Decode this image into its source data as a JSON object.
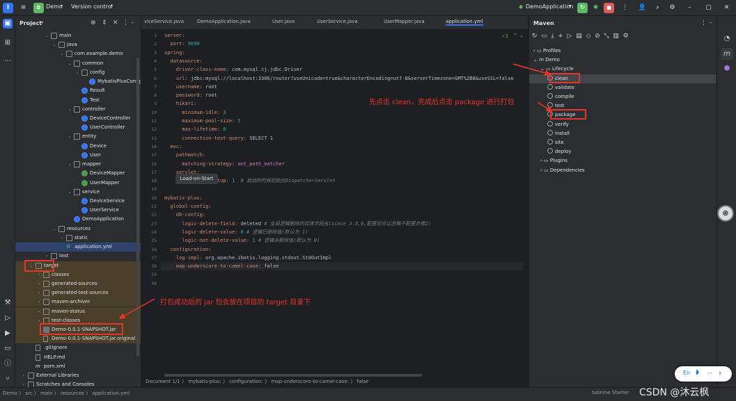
{
  "titlebar": {
    "project": "Demo",
    "vcs": "Version control",
    "run_config": "DemoApplication"
  },
  "project_panel": {
    "title": "Project",
    "tree": [
      {
        "label": "main",
        "indent": 3,
        "type": "folder",
        "open": true
      },
      {
        "label": "java",
        "indent": 4,
        "type": "folder",
        "open": true
      },
      {
        "label": "com.example.demo",
        "indent": 5,
        "type": "folder",
        "open": true
      },
      {
        "label": "common",
        "indent": 6,
        "type": "folder",
        "open": true
      },
      {
        "label": "config",
        "indent": 7,
        "type": "folder",
        "open": true
      },
      {
        "label": "MybatisPlusConfig",
        "indent": 8,
        "type": "class"
      },
      {
        "label": "Result",
        "indent": 7,
        "type": "class"
      },
      {
        "label": "Test",
        "indent": 7,
        "type": "class"
      },
      {
        "label": "controller",
        "indent": 6,
        "type": "folder",
        "open": true
      },
      {
        "label": "DeviceController",
        "indent": 7,
        "type": "class"
      },
      {
        "label": "UserController",
        "indent": 7,
        "type": "class"
      },
      {
        "label": "entity",
        "indent": 6,
        "type": "folder",
        "open": true
      },
      {
        "label": "Device",
        "indent": 7,
        "type": "class"
      },
      {
        "label": "User",
        "indent": 7,
        "type": "class"
      },
      {
        "label": "mapper",
        "indent": 6,
        "type": "folder",
        "open": true
      },
      {
        "label": "DeviceMapper",
        "indent": 7,
        "type": "interface"
      },
      {
        "label": "UserMapper",
        "indent": 7,
        "type": "interface"
      },
      {
        "label": "service",
        "indent": 6,
        "type": "folder",
        "open": true
      },
      {
        "label": "DeviceService",
        "indent": 7,
        "type": "class"
      },
      {
        "label": "UserService",
        "indent": 7,
        "type": "class"
      },
      {
        "label": "DemoApplication",
        "indent": 6,
        "type": "class"
      },
      {
        "label": "resources",
        "indent": 4,
        "type": "folder",
        "open": true
      },
      {
        "label": "static",
        "indent": 5,
        "type": "folder"
      },
      {
        "label": "application.yml",
        "indent": 5,
        "type": "yml",
        "selected": true
      },
      {
        "label": "test",
        "indent": 3,
        "type": "folder"
      },
      {
        "label": "target",
        "indent": 1,
        "type": "folder",
        "open": true,
        "orange": true
      },
      {
        "label": "classes",
        "indent": 2,
        "type": "folder",
        "orange": true
      },
      {
        "label": "generated-sources",
        "indent": 2,
        "type": "folder",
        "orange": true
      },
      {
        "label": "generated-test-sources",
        "indent": 2,
        "type": "folder",
        "orange": true
      },
      {
        "label": "maven-archiver",
        "indent": 2,
        "type": "folder",
        "orange": true
      },
      {
        "label": "maven-status",
        "indent": 2,
        "type": "folder",
        "orange": true
      },
      {
        "label": "test-classes",
        "indent": 2,
        "type": "folder",
        "orange": true
      },
      {
        "label": "Demo-0.0.1-SNAPSHOT.jar",
        "indent": 2,
        "type": "jar",
        "orange": true
      },
      {
        "label": "Demo-0.0.1-SNAPSHOT.jar.original",
        "indent": 2,
        "type": "file",
        "orange": true
      },
      {
        "label": ".gitignore",
        "indent": 1,
        "type": "file"
      },
      {
        "label": "HELP.md",
        "indent": 1,
        "type": "file"
      },
      {
        "label": "pom.xml",
        "indent": 1,
        "type": "pom"
      },
      {
        "label": "External Libraries",
        "indent": 0,
        "type": "lib"
      },
      {
        "label": "Scratches and Consoles",
        "indent": 0,
        "type": "lib"
      }
    ]
  },
  "editor": {
    "tabs": [
      "viceService.java",
      "DemoApplication.java",
      "User.java",
      "UserService.java",
      "UserMapper.java",
      "application.yml"
    ],
    "active_tab": "application.yml",
    "inspection": "✓1",
    "lines": [
      [
        [
          "k",
          "server:"
        ]
      ],
      [
        [
          "k",
          "  port: "
        ],
        [
          "n",
          "9090"
        ]
      ],
      [
        [
          "k",
          "spring:"
        ]
      ],
      [
        [
          "k",
          "  datasource:"
        ]
      ],
      [
        [
          "k",
          "    driver-class-name: "
        ],
        [
          "v",
          "com.mysql.cj.jdbc.Driver"
        ]
      ],
      [
        [
          "k",
          "    url: "
        ],
        [
          "v",
          "jdbc:mysql://localhost:3306/router?useUnicode=true&characterEncoding=utf-8&serverTimezone=GMT%2B8&useSSL=false"
        ]
      ],
      [
        [
          "k",
          "    username: "
        ],
        [
          "v",
          "root"
        ]
      ],
      [
        [
          "k",
          "    password: "
        ],
        [
          "v",
          "root"
        ]
      ],
      [
        [
          "k",
          "    hikari:"
        ]
      ],
      [
        [
          "k",
          "      minimum-idle: "
        ],
        [
          "n",
          "3"
        ]
      ],
      [
        [
          "k",
          "      maximum-pool-size: "
        ],
        [
          "n",
          "5"
        ]
      ],
      [
        [
          "k",
          "      max-lifetime: "
        ],
        [
          "n",
          "0"
        ]
      ],
      [
        [
          "k",
          "      connection-test-query: "
        ],
        [
          "v",
          "SELECT 1"
        ]
      ],
      [
        [
          "k",
          "  mvc:"
        ]
      ],
      [
        [
          "k",
          "    pathmatch:"
        ]
      ],
      [
        [
          "k",
          "      matching-strategy: "
        ],
        [
          "m",
          "ant_path_matcher"
        ]
      ],
      [
        [
          "k",
          "    servlet:"
        ]
      ],
      [
        [
          "k",
          "      load-on-startup: "
        ],
        [
          "n",
          "1"
        ],
        [
          "c",
          "  # 启动的时候初始化DispatcherServlet"
        ]
      ],
      [],
      [
        [
          "k",
          "mybatis-plus:"
        ]
      ],
      [
        [
          "k",
          "  global-config:"
        ]
      ],
      [
        [
          "k",
          "    db-config:"
        ]
      ],
      [
        [
          "k",
          "      logic-delete-field: "
        ],
        [
          "v",
          "deleted"
        ],
        [
          "c",
          " # 全局逻辑删除的实体字段名(since 3.3.0,配置后可以忽略不配置步骤2)"
        ]
      ],
      [
        [
          "k",
          "      logic-delete-value: "
        ],
        [
          "n",
          "0"
        ],
        [
          "c",
          " # 逻辑已删除值(默认为 1)"
        ]
      ],
      [
        [
          "k",
          "      logic-not-delete-value: "
        ],
        [
          "n",
          "1"
        ],
        [
          "c",
          " # 逻辑未删除值(默认为 0)"
        ]
      ],
      [
        [
          "k",
          "  configuration:"
        ]
      ],
      [
        [
          "k",
          "    log-impl: "
        ],
        [
          "v",
          "org.apache.ibatis.logging.stdout.StdOutImpl"
        ]
      ],
      [
        [
          "k",
          "    map-underscore-to-camel-case: "
        ],
        [
          "v",
          "false"
        ]
      ],
      [],
      []
    ],
    "hint": "Load-on-Start",
    "breadcrumbs": [
      "Document 1/1",
      "mybatis-plus:",
      "configuration:",
      "map-underscore-to-camel-case:",
      "false"
    ]
  },
  "maven": {
    "title": "Maven",
    "items": [
      {
        "label": "Profiles",
        "indent": 0,
        "kind": "folder"
      },
      {
        "label": "Demo",
        "indent": 0,
        "kind": "maven"
      },
      {
        "label": "Lifecycle",
        "indent": 1,
        "kind": "folder"
      },
      {
        "label": "clean",
        "indent": 2,
        "kind": "goal",
        "highlight": true
      },
      {
        "label": "validate",
        "indent": 2,
        "kind": "goal"
      },
      {
        "label": "compile",
        "indent": 2,
        "kind": "goal"
      },
      {
        "label": "test",
        "indent": 2,
        "kind": "goal"
      },
      {
        "label": "package",
        "indent": 2,
        "kind": "goal",
        "boxed": true
      },
      {
        "label": "verify",
        "indent": 2,
        "kind": "goal"
      },
      {
        "label": "install",
        "indent": 2,
        "kind": "goal"
      },
      {
        "label": "site",
        "indent": 2,
        "kind": "goal"
      },
      {
        "label": "deploy",
        "indent": 2,
        "kind": "goal"
      },
      {
        "label": "Plugins",
        "indent": 1,
        "kind": "folder"
      },
      {
        "label": "Dependencies",
        "indent": 1,
        "kind": "folder"
      }
    ]
  },
  "annotations": {
    "maven_note": "先点击 clean，完成后点击 package 进行打包",
    "target_note": "打包成功后的 jar 包会放在项目的 target 目录下"
  },
  "statusbar": {
    "path": [
      "Demo",
      "src",
      "main",
      "resources",
      "application.yml"
    ],
    "tabnine": "tabnine Starter",
    "watermark": "CSDN @沐云枫"
  },
  "lang_widget": {
    "label": "En"
  }
}
